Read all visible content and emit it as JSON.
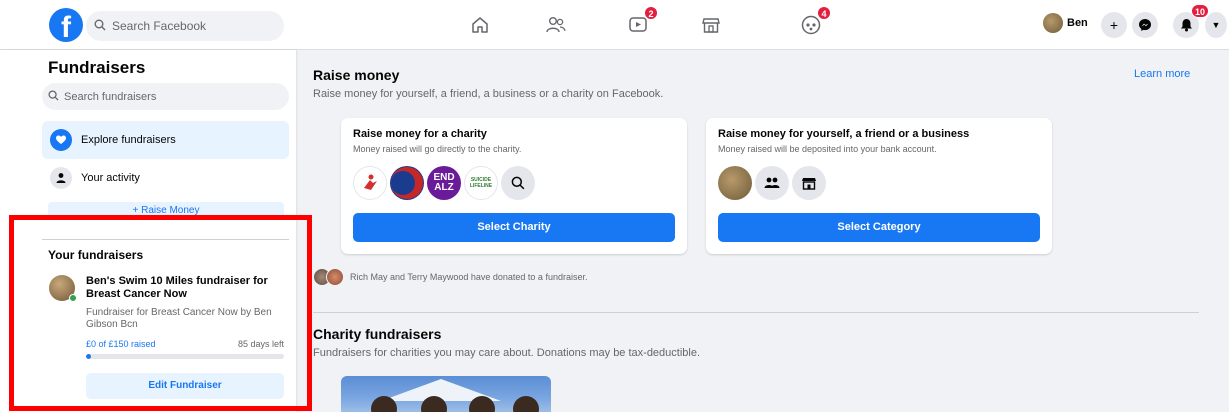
{
  "topbar": {
    "logo_letter": "f",
    "search_placeholder": "Search Facebook",
    "badges": {
      "watch": "2",
      "gaming": "4",
      "notifications": "10"
    },
    "profile_name": "Ben"
  },
  "sidebar": {
    "title": "Fundraisers",
    "search_placeholder": "Search fundraisers",
    "items": [
      {
        "label": "Explore fundraisers",
        "icon": "heart-hands-icon"
      },
      {
        "label": "Your activity",
        "icon": "person-icon"
      }
    ],
    "raise_money_label": "+ Raise Money",
    "your_fundraisers": {
      "heading": "Your fundraisers",
      "title": "Ben's Swim 10 Miles fundraiser for Breast Cancer Now",
      "subtitle": "Fundraiser for Breast Cancer Now by Ben Gibson Bcn",
      "raised": "£0 of £150 raised",
      "days_left": "85 days left",
      "progress": 0.0,
      "edit_label": "Edit Fundraiser"
    }
  },
  "main": {
    "raise_title": "Raise money",
    "raise_subtitle": "Raise money for yourself, a friend, a business or a charity on Facebook.",
    "learn_more": "Learn more",
    "cards": [
      {
        "title": "Raise money for a charity",
        "subtitle": "Money raised will go directly to the charity.",
        "button": "Select Charity"
      },
      {
        "title": "Raise money for yourself, a friend or a business",
        "subtitle": "Money raised will be deposited into your bank account.",
        "button": "Select Category"
      }
    ],
    "charity_logos": [
      "American Cancer Society",
      "END ALZ",
      "SUICIDE PREVENTION LIFELINE"
    ],
    "donated_text": "Rich May and Terry Maywood have donated to a fundraiser.",
    "charity_title": "Charity fundraisers",
    "charity_subtitle": "Fundraisers for charities you may care about. Donations may be tax-deductible."
  },
  "colors": {
    "accent": "#1877f2",
    "accent_light": "#e7f3ff",
    "highlight": "#ff0000",
    "badge": "#e41e3f"
  }
}
